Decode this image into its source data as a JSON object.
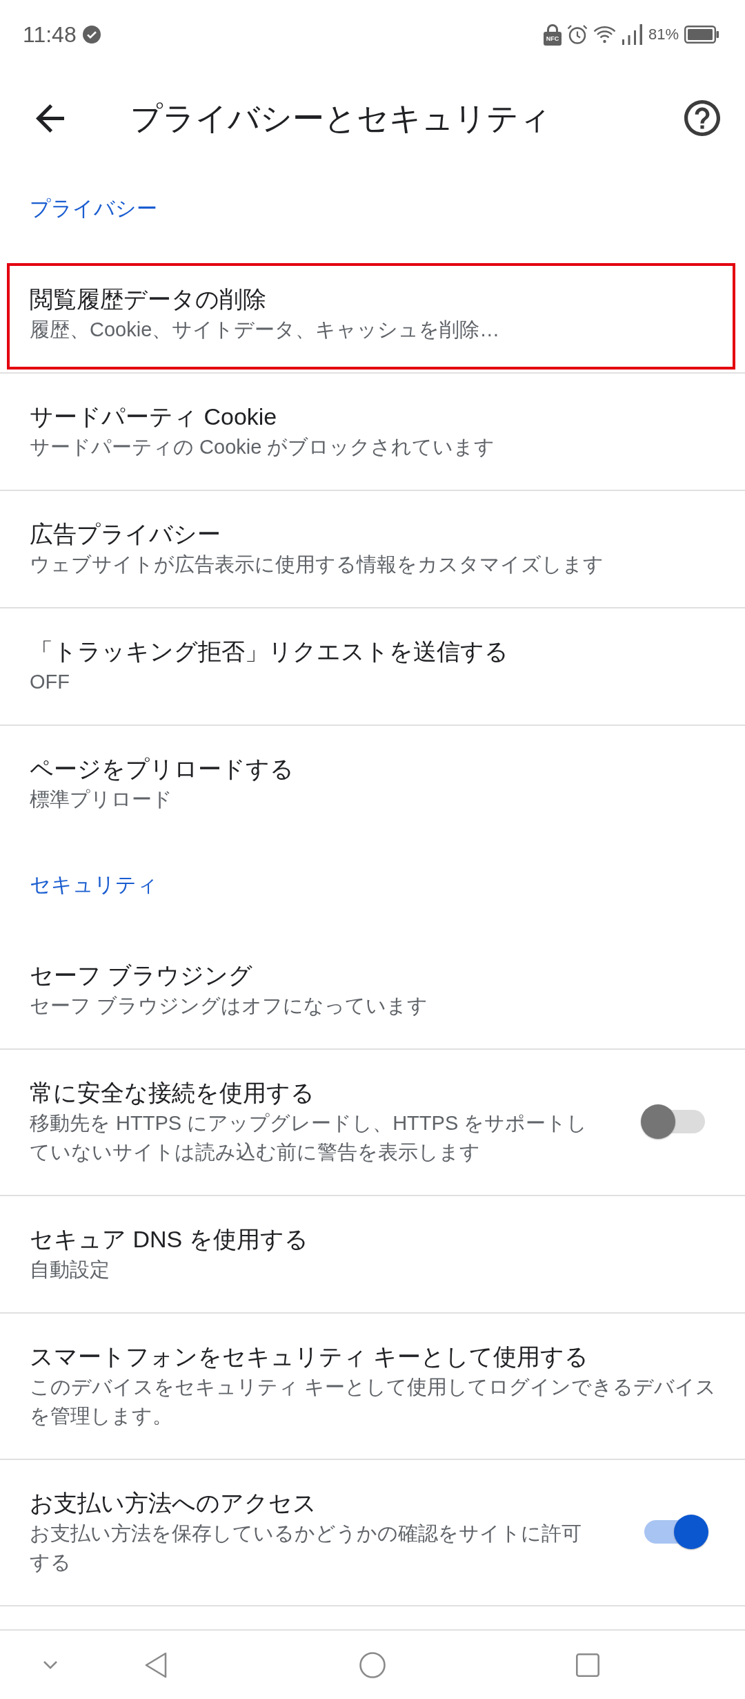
{
  "status_bar": {
    "time": "11:48",
    "nfc_label": "NFC",
    "battery_percent": "81%"
  },
  "toolbar": {
    "title": "プライバシーとセキュリティ"
  },
  "sections": [
    {
      "header": "プライバシー",
      "items": [
        {
          "kind": "link",
          "title": "閲覧履歴データの削除",
          "description": "履歴、Cookie、サイトデータ、キャッシュを削除…",
          "highlighted": true
        },
        {
          "kind": "link",
          "title": "サードパーティ Cookie",
          "description": "サードパーティの Cookie がブロックされています",
          "highlighted": false
        },
        {
          "kind": "link",
          "title": "広告プライバシー",
          "description": "ウェブサイトが広告表示に使用する情報をカスタマイズします",
          "highlighted": false
        },
        {
          "kind": "link",
          "title": "「トラッキング拒否」リクエストを送信する",
          "description": "OFF",
          "highlighted": false
        },
        {
          "kind": "link",
          "title": "ページをプリロードする",
          "description": "標準プリロード",
          "highlighted": false
        }
      ]
    },
    {
      "header": "セキュリティ",
      "items": [
        {
          "kind": "link",
          "title": "セーフ ブラウジング",
          "description": "セーフ ブラウジングはオフになっています",
          "highlighted": false
        },
        {
          "kind": "toggle",
          "title": "常に安全な接続を使用する",
          "description": "移動先を HTTPS にアップグレードし、HTTPS をサポートしていないサイトは読み込む前に警告を表示します",
          "on": false,
          "highlighted": false
        },
        {
          "kind": "link",
          "title": "セキュア DNS を使用する",
          "description": "自動設定",
          "highlighted": false
        },
        {
          "kind": "link",
          "title": "スマートフォンをセキュリティ キーとして使用する",
          "description": "このデバイスをセキュリティ キーとして使用してログインできるデバイスを管理します。",
          "highlighted": false
        },
        {
          "kind": "toggle",
          "title": "お支払い方法へのアクセス",
          "description": "お支払い方法を保存しているかどうかの確認をサイトに許可する",
          "on": true,
          "highlighted": false
        }
      ]
    }
  ]
}
